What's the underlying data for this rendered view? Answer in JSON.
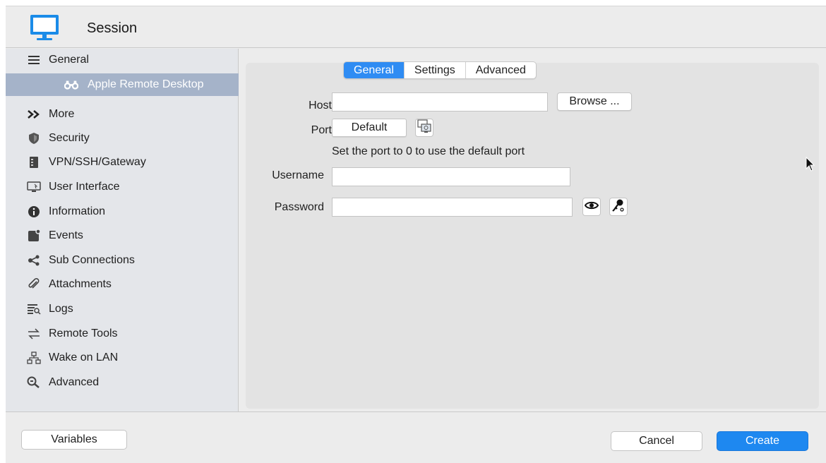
{
  "header": {
    "title": "Session"
  },
  "sidebar": {
    "items": [
      {
        "label": "General",
        "icon": "hamburger-icon"
      },
      {
        "label": "Apple Remote Desktop",
        "icon": "binoculars-icon",
        "selected": true
      },
      {
        "label": "More",
        "icon": "double-chevron-icon"
      },
      {
        "label": "Security",
        "icon": "shield-icon"
      },
      {
        "label": "VPN/SSH/Gateway",
        "icon": "server-icon"
      },
      {
        "label": "User Interface",
        "icon": "monitor-icon"
      },
      {
        "label": "Information",
        "icon": "info-icon"
      },
      {
        "label": "Events",
        "icon": "events-icon"
      },
      {
        "label": "Sub Connections",
        "icon": "share-icon"
      },
      {
        "label": "Attachments",
        "icon": "paperclip-icon"
      },
      {
        "label": "Logs",
        "icon": "logs-icon"
      },
      {
        "label": "Remote Tools",
        "icon": "arrows-icon"
      },
      {
        "label": "Wake on LAN",
        "icon": "network-icon"
      },
      {
        "label": "Advanced",
        "icon": "magnifier-icon"
      }
    ]
  },
  "tabs": [
    {
      "label": "General",
      "active": true
    },
    {
      "label": "Settings",
      "active": false
    },
    {
      "label": "Advanced",
      "active": false
    }
  ],
  "form": {
    "host_label": "Host",
    "host_value": "",
    "browse_label": "Browse ...",
    "port_label": "Port",
    "port_button_label": "Default",
    "port_hint": "Set the port to 0 to use the default port",
    "username_label": "Username",
    "username_value": "",
    "password_label": "Password",
    "password_value": ""
  },
  "footer": {
    "variables_label": "Variables",
    "cancel_label": "Cancel",
    "create_label": "Create"
  },
  "colors": {
    "accent": "#2f8cf3",
    "selected_sidebar": "#a5b3c9"
  }
}
